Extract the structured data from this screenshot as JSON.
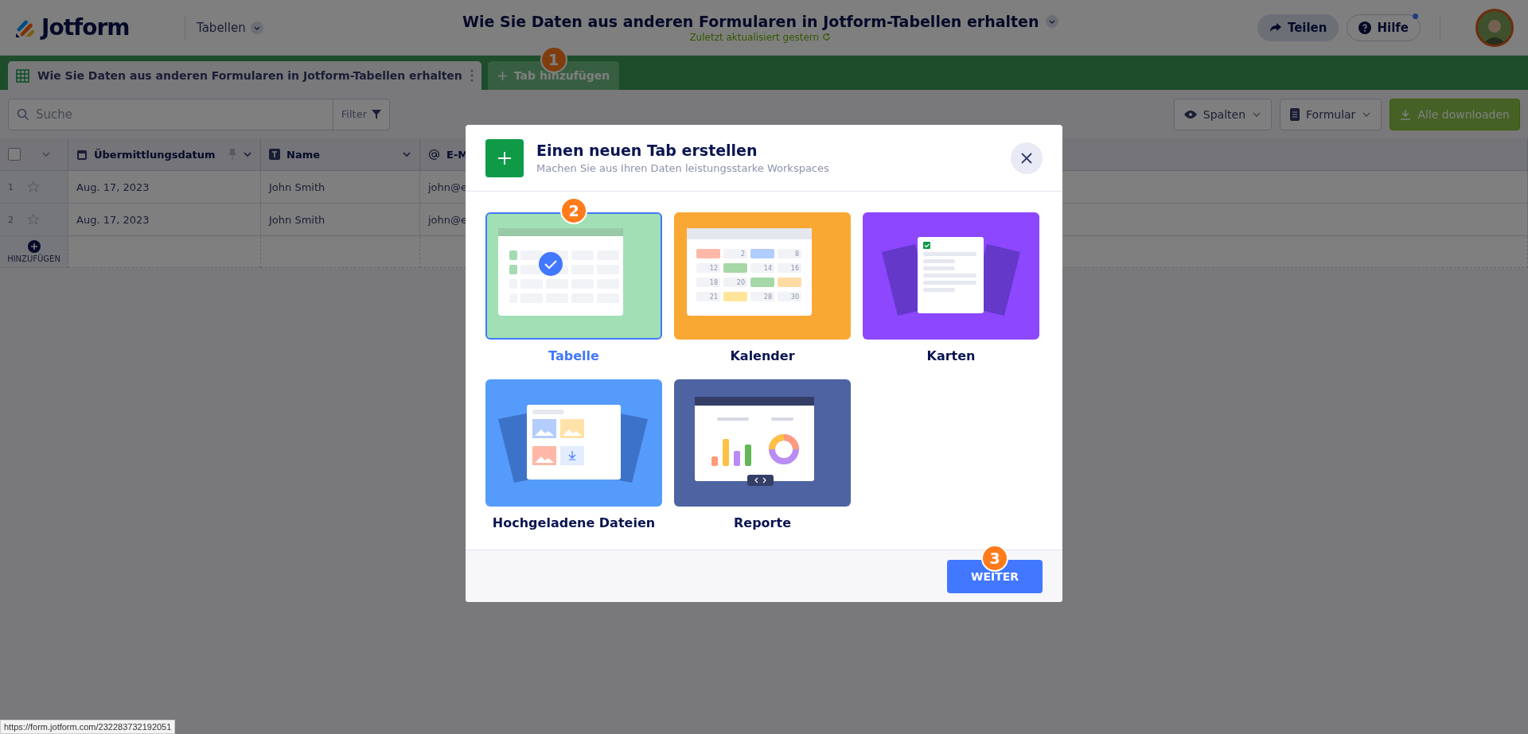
{
  "header": {
    "logo_text": "Jotform",
    "workspace": "Tabellen",
    "title": "Wie Sie Daten aus anderen Formularen in Jotform-Tabellen erhalten",
    "subtitle": "Zuletzt aktualisiert gestern",
    "share_button": "Teilen",
    "help_button": "Hilfe"
  },
  "tabs": [
    {
      "label": "Wie Sie Daten aus anderen Formularen in Jotform-Tabellen erhalten",
      "selected": true
    }
  ],
  "add_tab": {
    "label": "Tab hinzufügen",
    "step": "1"
  },
  "toolbar": {
    "search": {
      "placeholder": "Suche"
    },
    "filter": "Filter",
    "buttons": [
      {
        "kind": "columns",
        "label": "Spalten"
      },
      {
        "kind": "form",
        "label": "Formular"
      },
      {
        "kind": "download",
        "label": "Alle downloaden"
      }
    ]
  },
  "table": {
    "select_all": {
      "checked": false
    },
    "columns": [
      {
        "kind": "date",
        "label": "Übermittlungsdatum"
      },
      {
        "kind": "text",
        "label": "Name"
      },
      {
        "kind": "email",
        "label": "E-M"
      }
    ],
    "rows": [
      {
        "number": "1",
        "cells": [
          "Aug. 17, 2023",
          "John Smith",
          "john@e"
        ]
      },
      {
        "number": "2",
        "cells": [
          "Aug. 17, 2023",
          "John Smith",
          "john@e"
        ]
      }
    ],
    "add_row": "HINZUFÜGEN"
  },
  "modal": {
    "title": "Einen neuen Tab erstellen",
    "subtitle": "Machen Sie aus Ihren Daten leistungsstarke Workspaces",
    "options": [
      {
        "kind": "table",
        "label": "Tabelle",
        "selected": true,
        "step": "2"
      },
      {
        "kind": "calendar",
        "label": "Kalender",
        "selected": false,
        "day_numbers": [
          "2",
          "8",
          "12",
          "14",
          "16",
          "18",
          "20",
          "21",
          "28",
          "30"
        ]
      },
      {
        "kind": "cards",
        "label": "Karten",
        "selected": false
      },
      {
        "kind": "uploads",
        "label": "Hochgeladene Dateien",
        "selected": false
      },
      {
        "kind": "reports",
        "label": "Reporte",
        "selected": false
      }
    ],
    "button": "WEITER",
    "button_step": "3"
  },
  "status_url": "https://form.jotform.com/232283732192051"
}
